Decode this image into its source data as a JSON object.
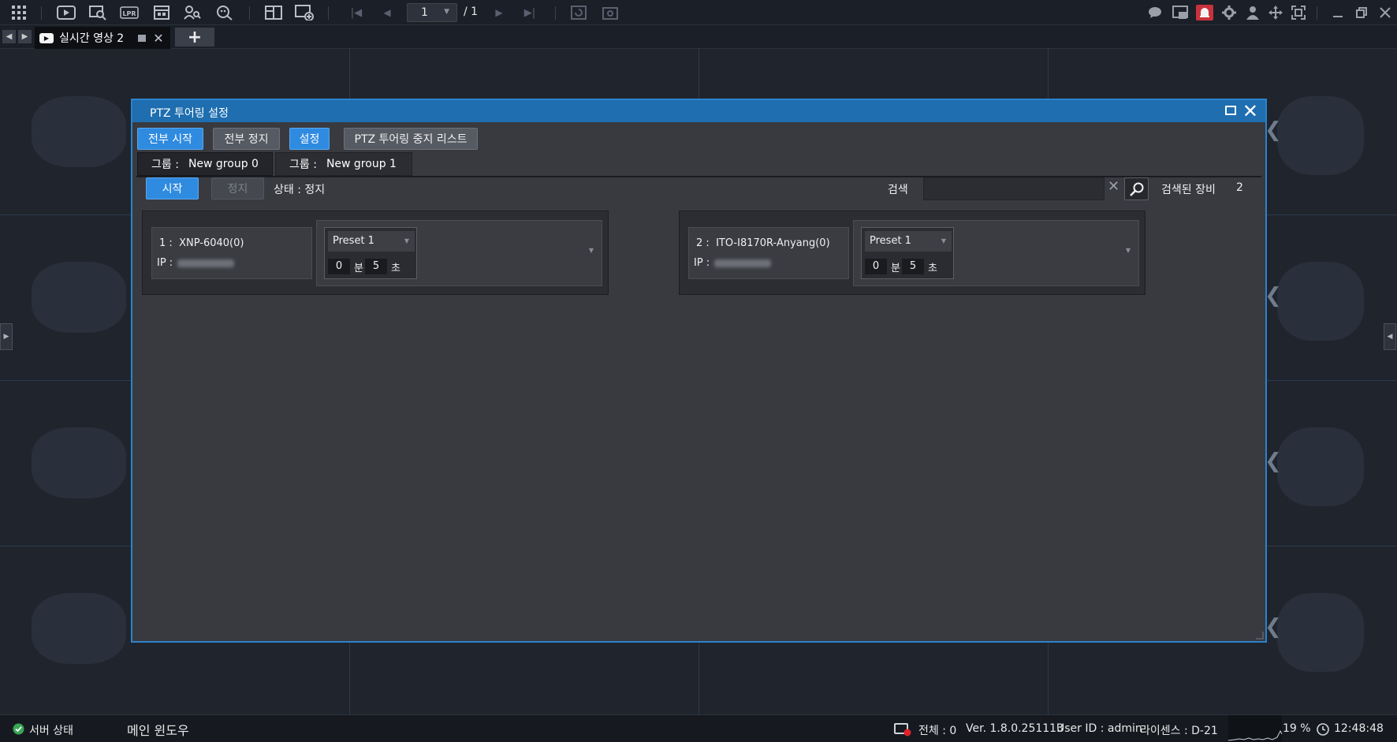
{
  "toolbar": {
    "current_page": "1",
    "total_pages": "/ 1"
  },
  "tabs": {
    "live_tab_label": "실시간 영상 2"
  },
  "dialog": {
    "title": "PTZ 투어링 설정",
    "buttons": {
      "start_all": "전부 시작",
      "stop_all": "전부 정지",
      "settings": "설정",
      "stop_list": "PTZ 투어링 중지 리스트"
    },
    "groups": [
      {
        "label": "그룹 :",
        "name": "New group 0"
      },
      {
        "label": "그룹 :",
        "name": "New group 1"
      }
    ],
    "start_label": "시작",
    "stop_label": "정지",
    "status_text": "상태 : 정지",
    "search_label": "검색",
    "search_value": "",
    "found_label": "검색된 장비",
    "found_count": "2",
    "devices": [
      {
        "index": "1 :",
        "name": "XNP-6040(0)",
        "ip_label": "IP :",
        "preset": "Preset 1",
        "minutes": "0",
        "min_unit": "분",
        "seconds": "5",
        "sec_unit": "초"
      },
      {
        "index": "2 :",
        "name": "ITO-I8170R-Anyang(0)",
        "ip_label": "IP :",
        "preset": "Preset 1",
        "minutes": "0",
        "min_unit": "분",
        "seconds": "5",
        "sec_unit": "초"
      }
    ]
  },
  "statusbar": {
    "server_status": "서버 상태",
    "main_window": "메인 윈도우",
    "total": "전체 : 0",
    "version": "Ver. 1.8.0.251113",
    "user": "User ID : admin",
    "license": "라이센스 : D-21",
    "cpu": "19 %",
    "clock": "12:48:48"
  },
  "colors": {
    "accent": "#2f8be0",
    "title_bar": "#1e6eb0",
    "dialog_bg": "#383a40",
    "alarm": "#c8323c"
  },
  "icons": [
    "grid-icon",
    "play-icon",
    "search-playback-icon",
    "lpr-icon",
    "export-icon",
    "person-search-icon",
    "face-search-icon",
    "layout-icon",
    "add-layout-icon",
    "first-page-icon",
    "prev-page-icon",
    "next-page-icon",
    "last-page-icon",
    "refresh-icon",
    "capture-icon",
    "chat-icon",
    "monitor-icon",
    "alarm-icon",
    "gear-icon",
    "user-icon",
    "move-icon",
    "fullscreen-icon",
    "minimize-icon",
    "restore-icon",
    "close-icon"
  ]
}
